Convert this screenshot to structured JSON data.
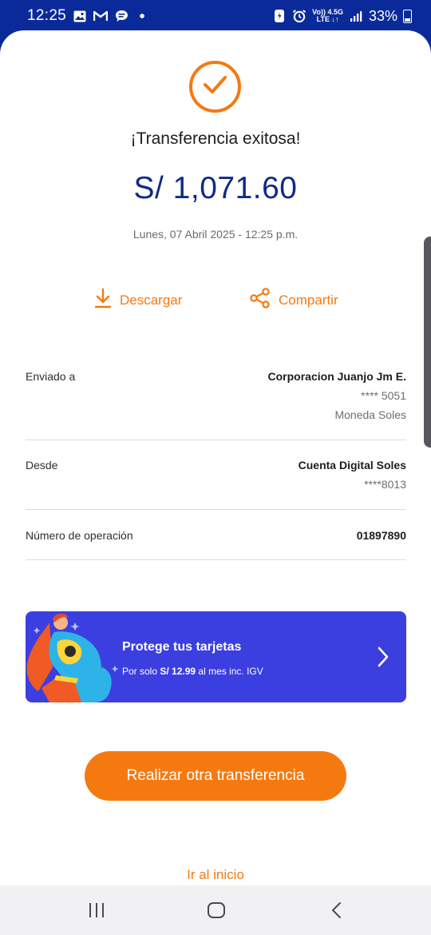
{
  "status_bar": {
    "time": "12:25",
    "icons_left": [
      "image-icon",
      "gmail-icon",
      "chat-icon",
      "dot-icon"
    ],
    "network_top": "Vo)) 4.5G",
    "network_bottom": "LTE ↓↑",
    "battery": "33%",
    "colors": {
      "background": "#0b2a9a",
      "text": "#ffffff"
    }
  },
  "receipt": {
    "title": "¡Transferencia exitosa!",
    "amount": "S/ 1,071.60",
    "datetime": "Lunes, 07 Abril 2025 - 12:25 p.m.",
    "actions": {
      "download": "Descargar",
      "share": "Compartir"
    }
  },
  "details": {
    "sent_to": {
      "label": "Enviado a",
      "name": "Corporacion Juanjo Jm E.",
      "account": "**** 5051",
      "currency": "Moneda Soles"
    },
    "from": {
      "label": "Desde",
      "account_name": "Cuenta Digital Soles",
      "account": "****8013"
    },
    "operation": {
      "label": "Número de operación",
      "number": "01897890"
    }
  },
  "promo": {
    "title": "Protege tus tarjetas",
    "sub_prefix": "Por solo ",
    "sub_price": "S/ 12.99",
    "sub_suffix": " al mes inc. IGV",
    "color": "#3b3fe0"
  },
  "buttons": {
    "new_transfer": "Realizar otra transferencia",
    "go_home": "Ir al inicio"
  },
  "colors": {
    "accent": "#f47a10",
    "amount": "#102a86"
  },
  "system_nav": [
    "recents-icon",
    "home-icon",
    "back-icon"
  ]
}
